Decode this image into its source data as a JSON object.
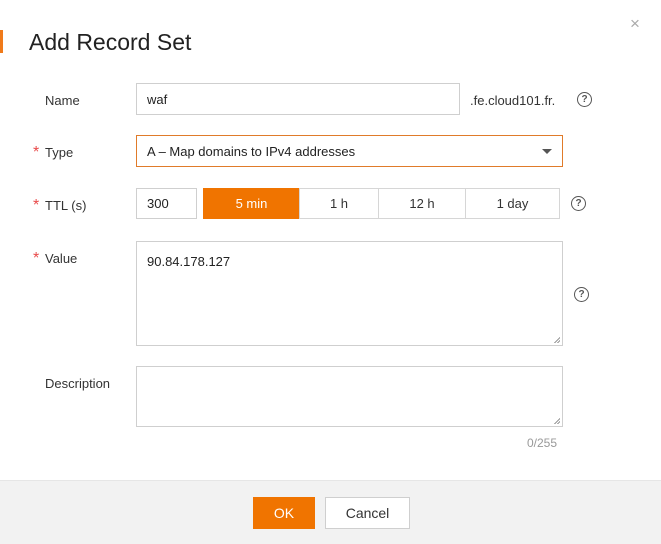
{
  "dialog": {
    "title": "Add Record Set",
    "close_glyph": "×"
  },
  "form": {
    "required_mark": "*",
    "name": {
      "label": "Name",
      "value": "waf",
      "suffix": ".fe.cloud101.fr."
    },
    "type": {
      "label": "Type",
      "value": "A – Map domains to IPv4 addresses"
    },
    "ttl": {
      "label": "TTL (s)",
      "value": "300",
      "presets": [
        "5 min",
        "1 h",
        "12 h",
        "1 day"
      ],
      "selected_preset": "5 min"
    },
    "value": {
      "label": "Value",
      "text": "90.84.178.127"
    },
    "description": {
      "label": "Description",
      "text": "",
      "counter": "0/255"
    },
    "help_glyph": "?"
  },
  "footer": {
    "ok_label": "OK",
    "cancel_label": "Cancel"
  },
  "colors": {
    "accent": "#f07400",
    "required": "#e84a4a",
    "focus_border": "#e07b2a"
  }
}
